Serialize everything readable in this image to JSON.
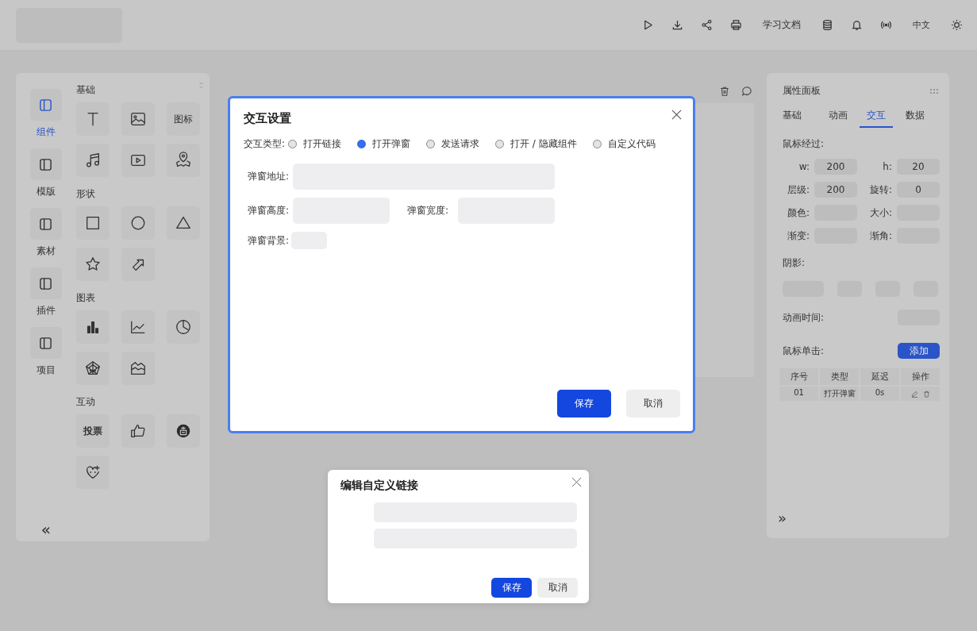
{
  "header": {
    "doc_link": "学习文档",
    "language": "中文"
  },
  "left_nav": [
    {
      "label": "组件",
      "selected": true
    },
    {
      "label": "模版",
      "selected": false
    },
    {
      "label": "素材",
      "selected": false
    },
    {
      "label": "插件",
      "selected": false
    },
    {
      "label": "项目",
      "selected": false
    }
  ],
  "component_groups": [
    {
      "title": "基础",
      "items": [
        {
          "kind": "icon"
        },
        {
          "kind": "icon"
        },
        {
          "kind": "text",
          "label": "图标"
        },
        {
          "kind": "icon"
        },
        {
          "kind": "icon"
        },
        {
          "kind": "icon"
        }
      ]
    },
    {
      "title": "形状",
      "items": [
        {
          "kind": "icon"
        },
        {
          "kind": "icon"
        },
        {
          "kind": "icon"
        },
        {
          "kind": "icon"
        },
        {
          "kind": "icon"
        }
      ]
    },
    {
      "title": "图表",
      "items": [
        {
          "kind": "icon"
        },
        {
          "kind": "icon"
        },
        {
          "kind": "icon"
        },
        {
          "kind": "icon"
        },
        {
          "kind": "icon"
        }
      ]
    },
    {
      "title": "互动",
      "items": [
        {
          "kind": "text",
          "label": "投票"
        },
        {
          "kind": "icon"
        },
        {
          "kind": "icon"
        },
        {
          "kind": "icon"
        }
      ]
    }
  ],
  "left_collapse": "«",
  "properties": {
    "title": "属性面板",
    "tabs": [
      {
        "label": "基础",
        "selected": false
      },
      {
        "label": "动画",
        "selected": false
      },
      {
        "label": "交互",
        "selected": true
      },
      {
        "label": "数据",
        "selected": false
      }
    ],
    "hover_label": "鼠标经过:",
    "fields": [
      {
        "label": "w:",
        "value": "200"
      },
      {
        "label": "h:",
        "value": "20"
      },
      {
        "label": "层级:",
        "value": "200"
      },
      {
        "label": "旋转:",
        "value": "0"
      },
      {
        "label": "颜色:"
      },
      {
        "label": "大小:"
      },
      {
        "label": "渐变:"
      },
      {
        "label": "渐角:"
      }
    ],
    "shadow_label": "阴影:",
    "animation_time_label": "动画时间:",
    "click_label": "鼠标单击:",
    "add_button": "添加",
    "table": {
      "columns": [
        "序号",
        "类型",
        "延迟",
        "操作"
      ],
      "rows": [
        [
          "01",
          "打开弹窗",
          "0s"
        ]
      ]
    },
    "expand": "»"
  },
  "interaction_dialog": {
    "title": "交互设置",
    "type_label": "交互类型:",
    "options": [
      {
        "label": "打开链接",
        "selected": false
      },
      {
        "label": "打开弹窗",
        "selected": true
      },
      {
        "label": "发送请求",
        "selected": false
      },
      {
        "label": "打开 / 隐藏组件",
        "selected": false
      },
      {
        "label": "自定义代码",
        "selected": false
      }
    ],
    "address_label": "弹窗地址:",
    "height_label": "弹窗高度:",
    "width_label": "弹窗宽度:",
    "background_label": "弹窗背景:",
    "save": "保存",
    "cancel": "取消"
  },
  "link_dialog": {
    "title": "编辑自定义链接",
    "save": "保存",
    "cancel": "取消"
  }
}
